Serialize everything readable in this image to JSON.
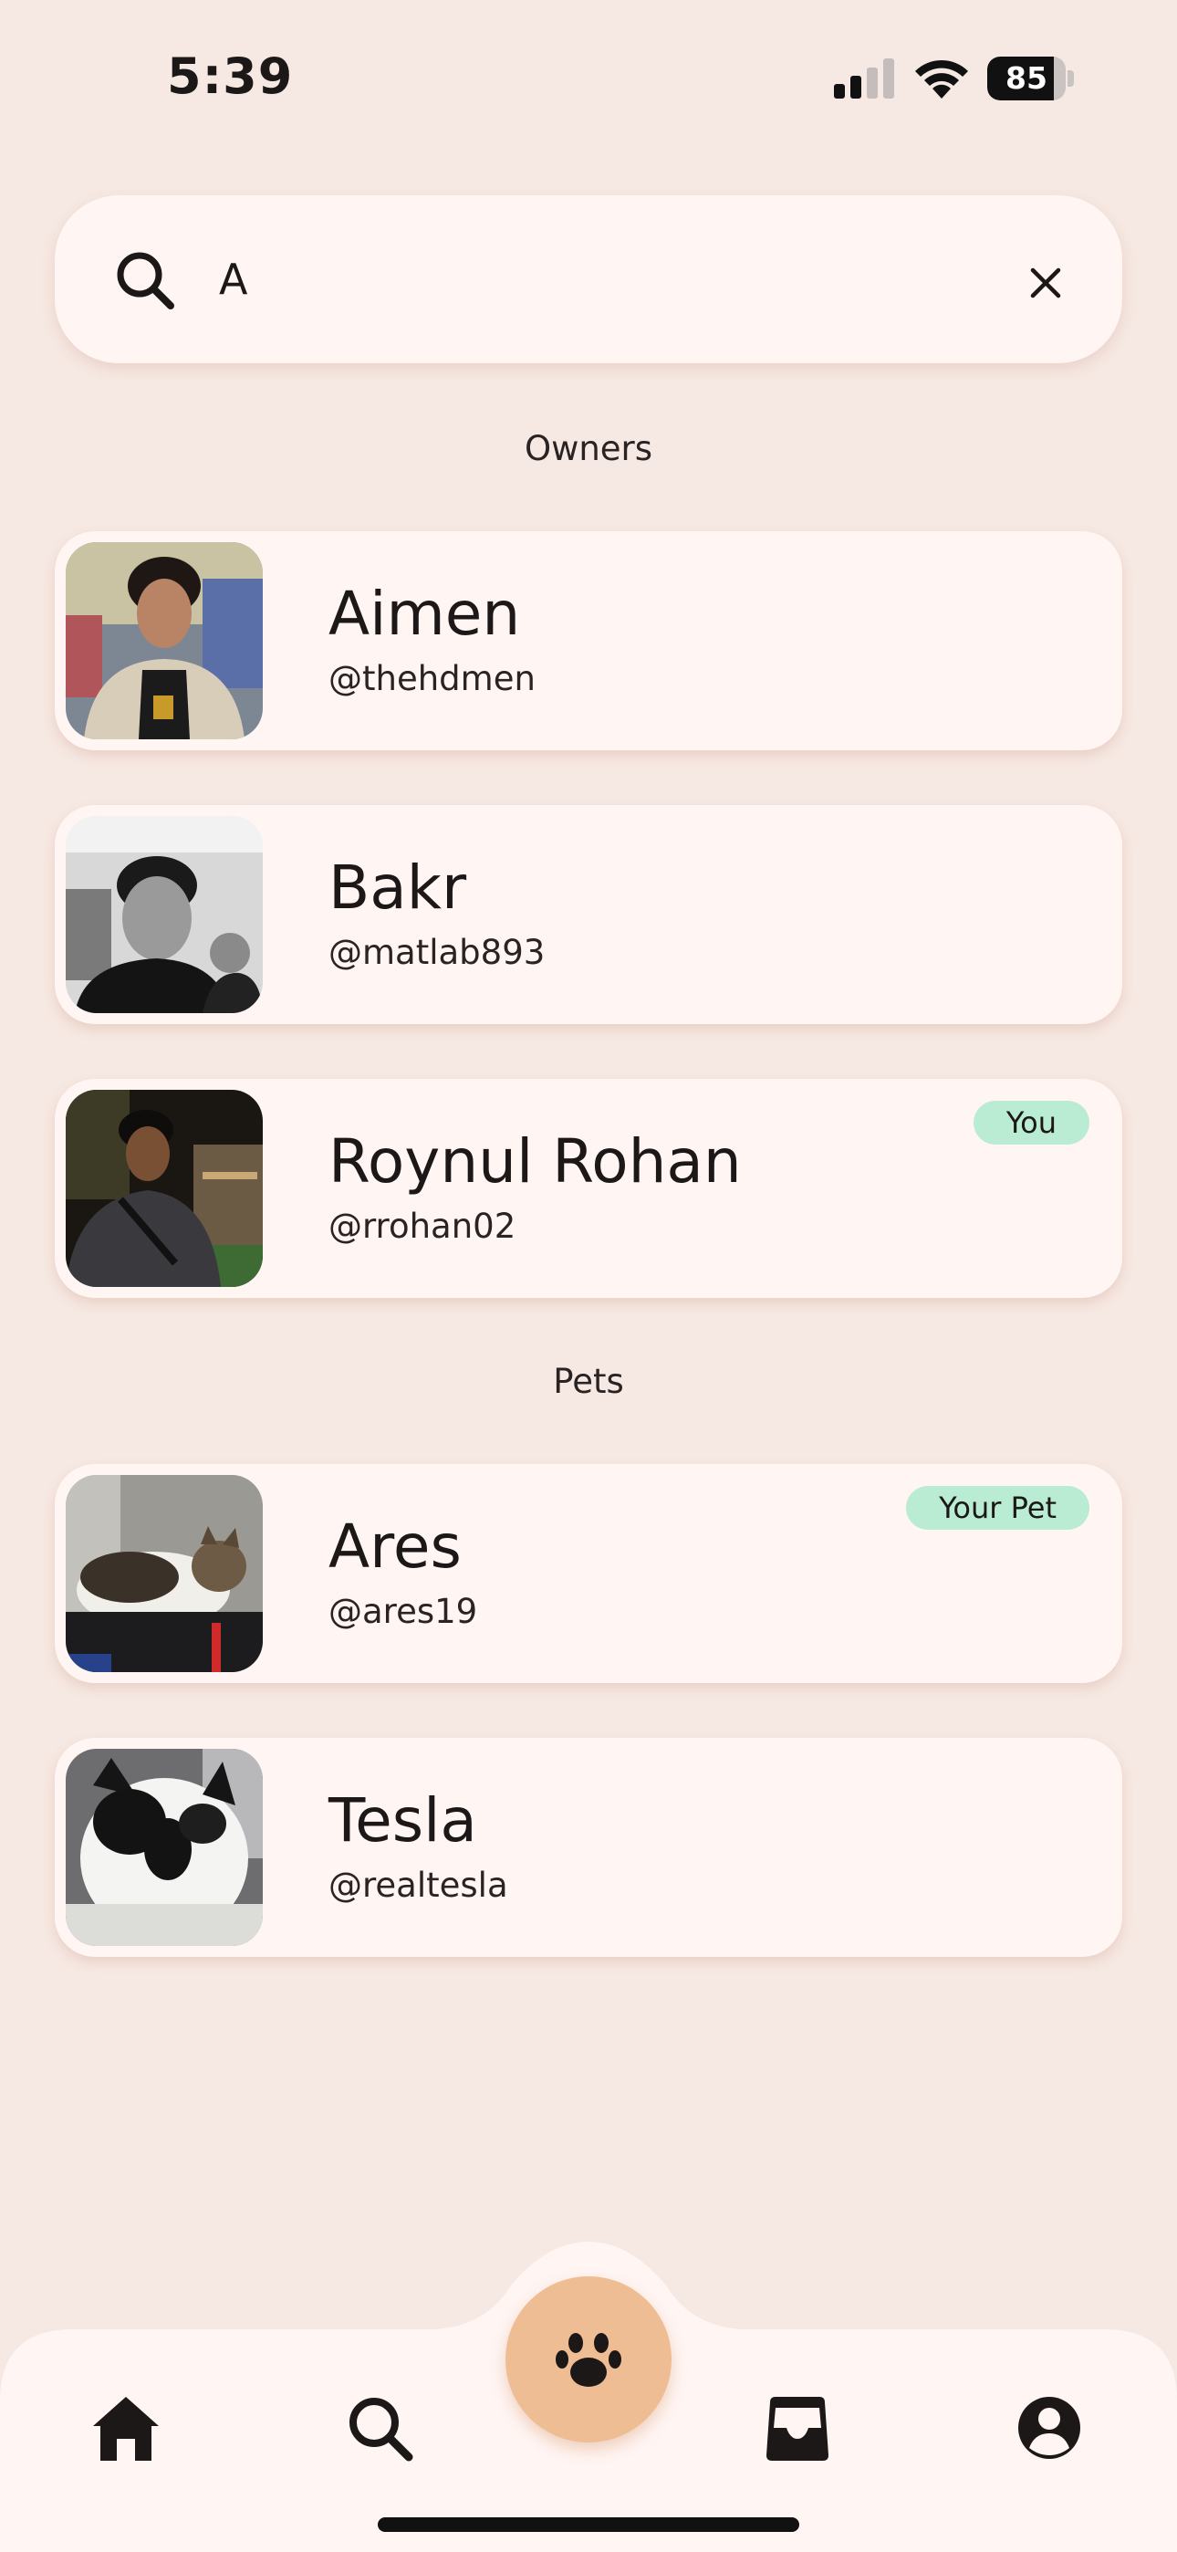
{
  "status_bar": {
    "time": "5:39",
    "battery": "85",
    "battery_level": 0.85
  },
  "search": {
    "value": "A",
    "placeholder": ""
  },
  "sections": {
    "owners_title": "Owners",
    "pets_title": "Pets"
  },
  "owners": [
    {
      "name": "Aimen",
      "handle": "@thehdmen",
      "badge": ""
    },
    {
      "name": "Bakr",
      "handle": "@matlab893",
      "badge": ""
    },
    {
      "name": "Roynul Rohan",
      "handle": "@rrohan02",
      "badge": "You"
    }
  ],
  "pets": [
    {
      "name": "Ares",
      "handle": "@ares19",
      "badge": "Your Pet"
    },
    {
      "name": "Tesla",
      "handle": "@realtesla",
      "badge": ""
    }
  ],
  "nav": {
    "items": [
      "home-icon",
      "search-icon",
      "paw-icon",
      "inbox-icon",
      "profile-icon"
    ]
  },
  "colors": {
    "background": "#f6e8e2",
    "card": "#fff5f3",
    "badge": "#b9ecd2",
    "fab": "#eebd93"
  }
}
